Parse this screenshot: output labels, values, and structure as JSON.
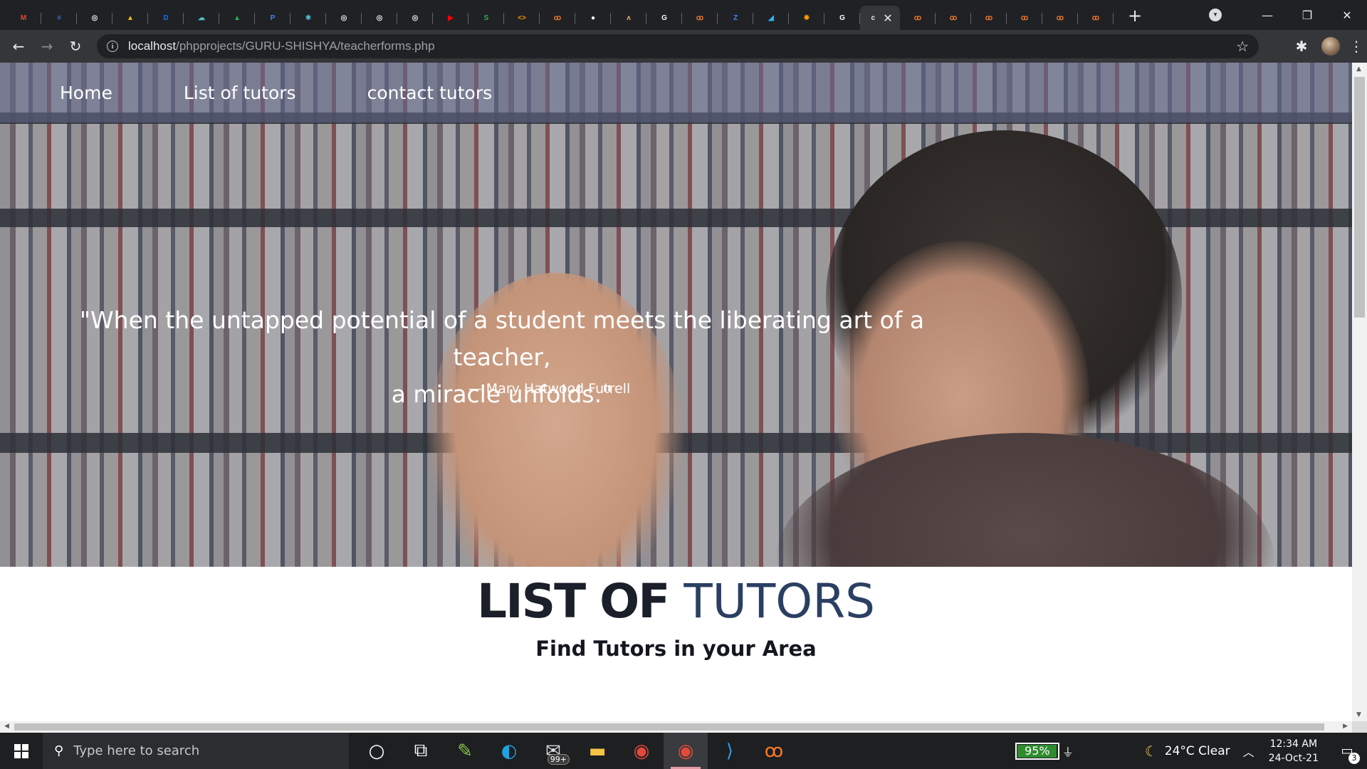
{
  "browser": {
    "tabs": [
      {
        "icon": "gmail-icon",
        "color": "#ea4335",
        "glyph": "M"
      },
      {
        "icon": "docs-icon",
        "color": "#4285f4",
        "glyph": "≡"
      },
      {
        "icon": "site-icon",
        "color": "#e8eaed",
        "glyph": "◎"
      },
      {
        "icon": "drive-icon",
        "color": "#fbbc04",
        "glyph": "▲"
      },
      {
        "icon": "site-icon",
        "color": "#1a73e8",
        "glyph": "D"
      },
      {
        "icon": "cloud-icon",
        "color": "#4fc3c8",
        "glyph": "☁"
      },
      {
        "icon": "drive-icon",
        "color": "#34a853",
        "glyph": "▲"
      },
      {
        "icon": "site-icon",
        "color": "#4285f4",
        "glyph": "P"
      },
      {
        "icon": "react-icon",
        "color": "#61dafb",
        "glyph": "⚛"
      },
      {
        "icon": "site-icon",
        "color": "#e8eaed",
        "glyph": "◎"
      },
      {
        "icon": "site-icon",
        "color": "#e8eaed",
        "glyph": "◎"
      },
      {
        "icon": "site-icon",
        "color": "#e8eaed",
        "glyph": "◎"
      },
      {
        "icon": "youtube-icon",
        "color": "#ff0000",
        "glyph": "▶"
      },
      {
        "icon": "site-icon",
        "color": "#34a853",
        "glyph": "S"
      },
      {
        "icon": "code-icon",
        "color": "#f29900",
        "glyph": "<>"
      },
      {
        "icon": "xampp-icon",
        "color": "#fb7a24",
        "glyph": "ꝏ"
      },
      {
        "icon": "github-icon",
        "color": "#ffffff",
        "glyph": "●"
      },
      {
        "icon": "site-icon",
        "color": "#f6b26b",
        "glyph": "ʌ"
      },
      {
        "icon": "google-icon",
        "color": "#ffffff",
        "glyph": "G"
      },
      {
        "icon": "xampp-icon",
        "color": "#fb7a24",
        "glyph": "ꝏ"
      },
      {
        "icon": "site-icon",
        "color": "#4285f4",
        "glyph": "Z"
      },
      {
        "icon": "site-icon",
        "color": "#29b6f6",
        "glyph": "◢"
      },
      {
        "icon": "site-icon",
        "color": "#ff9800",
        "glyph": "✹"
      },
      {
        "icon": "google-icon",
        "color": "#ffffff",
        "glyph": "G"
      },
      {
        "icon": "active-tab-icon",
        "color": "#e8eaed",
        "glyph": "c",
        "active": true
      },
      {
        "icon": "xampp-icon",
        "color": "#fb7a24",
        "glyph": "ꝏ"
      },
      {
        "icon": "xampp-icon",
        "color": "#fb7a24",
        "glyph": "ꝏ"
      },
      {
        "icon": "xampp-icon",
        "color": "#fb7a24",
        "glyph": "ꝏ"
      },
      {
        "icon": "xampp-icon",
        "color": "#fb7a24",
        "glyph": "ꝏ"
      },
      {
        "icon": "xampp-icon",
        "color": "#fb7a24",
        "glyph": "ꝏ"
      },
      {
        "icon": "xampp-icon",
        "color": "#fb7a24",
        "glyph": "ꝏ"
      }
    ],
    "url_host": "localhost",
    "url_path": "/phpprojects/GURU-SHISHYA/teacherforms.php"
  },
  "page": {
    "nav": [
      "Home",
      "List of tutors",
      "contact tutors"
    ],
    "quote_line1": "\"When the untapped potential of a student meets the liberating art of a teacher,",
    "quote_line2": "a miracle unfolds.\"",
    "quote_author": "— Mary Hatwood Futrell",
    "section_title_bold": "LIST OF",
    "section_title_light": "TUTORS",
    "section_subtitle": "Find Tutors in your Area"
  },
  "taskbar": {
    "search_placeholder": "Type here to search",
    "apps": [
      {
        "name": "cortana-icon",
        "glyph": "○",
        "color": "#ffffff"
      },
      {
        "name": "task-view-icon",
        "glyph": "⧉",
        "color": "#ffffff"
      },
      {
        "name": "pen-app-icon",
        "glyph": "✎",
        "color": "#8bc34a"
      },
      {
        "name": "edge-icon",
        "glyph": "◐",
        "color": "#1fa0e0"
      },
      {
        "name": "mail-icon",
        "glyph": "✉",
        "color": "#e0e0e0",
        "badge": "99+"
      },
      {
        "name": "file-explorer-icon",
        "glyph": "▬",
        "color": "#f6c343"
      },
      {
        "name": "chrome-icon",
        "glyph": "◉",
        "color": "#e5493a"
      },
      {
        "name": "chrome-icon",
        "glyph": "◉",
        "color": "#e5493a",
        "active": true
      },
      {
        "name": "vscode-icon",
        "glyph": "⟩",
        "color": "#2d9bf0"
      },
      {
        "name": "xampp-icon",
        "glyph": "ꝏ",
        "color": "#fb7a24"
      }
    ],
    "battery": "95%",
    "battery_level": 0.95,
    "weather": "24°C  Clear",
    "time": "12:34 AM",
    "date": "24-Oct-21",
    "notifications": "3"
  }
}
